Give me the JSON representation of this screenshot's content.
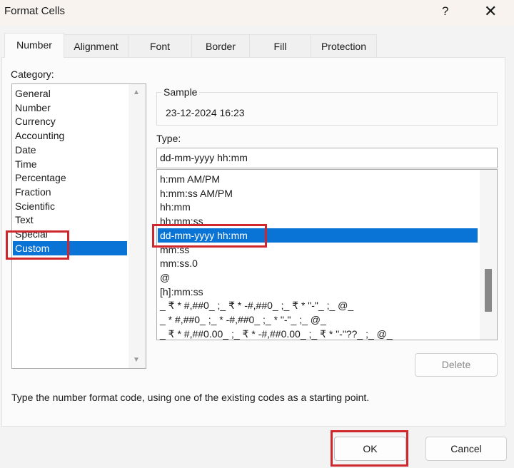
{
  "window": {
    "title": "Format Cells",
    "help": "?",
    "close": "✕"
  },
  "tabs": [
    "Number",
    "Alignment",
    "Font",
    "Border",
    "Fill",
    "Protection"
  ],
  "category": {
    "label": "Category:",
    "items": [
      "General",
      "Number",
      "Currency",
      "Accounting",
      "Date",
      "Time",
      "Percentage",
      "Fraction",
      "Scientific",
      "Text",
      "Special",
      "Custom"
    ],
    "selected": "Custom"
  },
  "sample": {
    "label": "Sample",
    "value": "23-12-2024 16:23"
  },
  "type": {
    "label": "Type:",
    "value": "dd-mm-yyyy hh:mm",
    "items": [
      "h:mm AM/PM",
      "h:mm:ss AM/PM",
      "hh:mm",
      "hh:mm:ss",
      "dd-mm-yyyy hh:mm",
      "mm:ss",
      "mm:ss.0",
      "@",
      "[h]:mm:ss",
      "_ ₹ * #,##0_ ;_ ₹ * -#,##0_ ;_ ₹ * \"-\"_ ;_ @_",
      "_ * #,##0_ ;_ * -#,##0_ ;_ * \"-\"_ ;_ @_",
      "_ ₹ * #,##0.00_ ;_ ₹ * -#,##0.00_ ;_ ₹ * \"-\"??_ ;_ @_"
    ],
    "selected": "dd-mm-yyyy hh:mm"
  },
  "delete_label": "Delete",
  "hint": "Type the number format code, using one of the existing codes as a starting point.",
  "ok_label": "OK",
  "cancel_label": "Cancel",
  "colors": {
    "selection": "#0a74d6",
    "highlight_box": "#d0262e"
  }
}
